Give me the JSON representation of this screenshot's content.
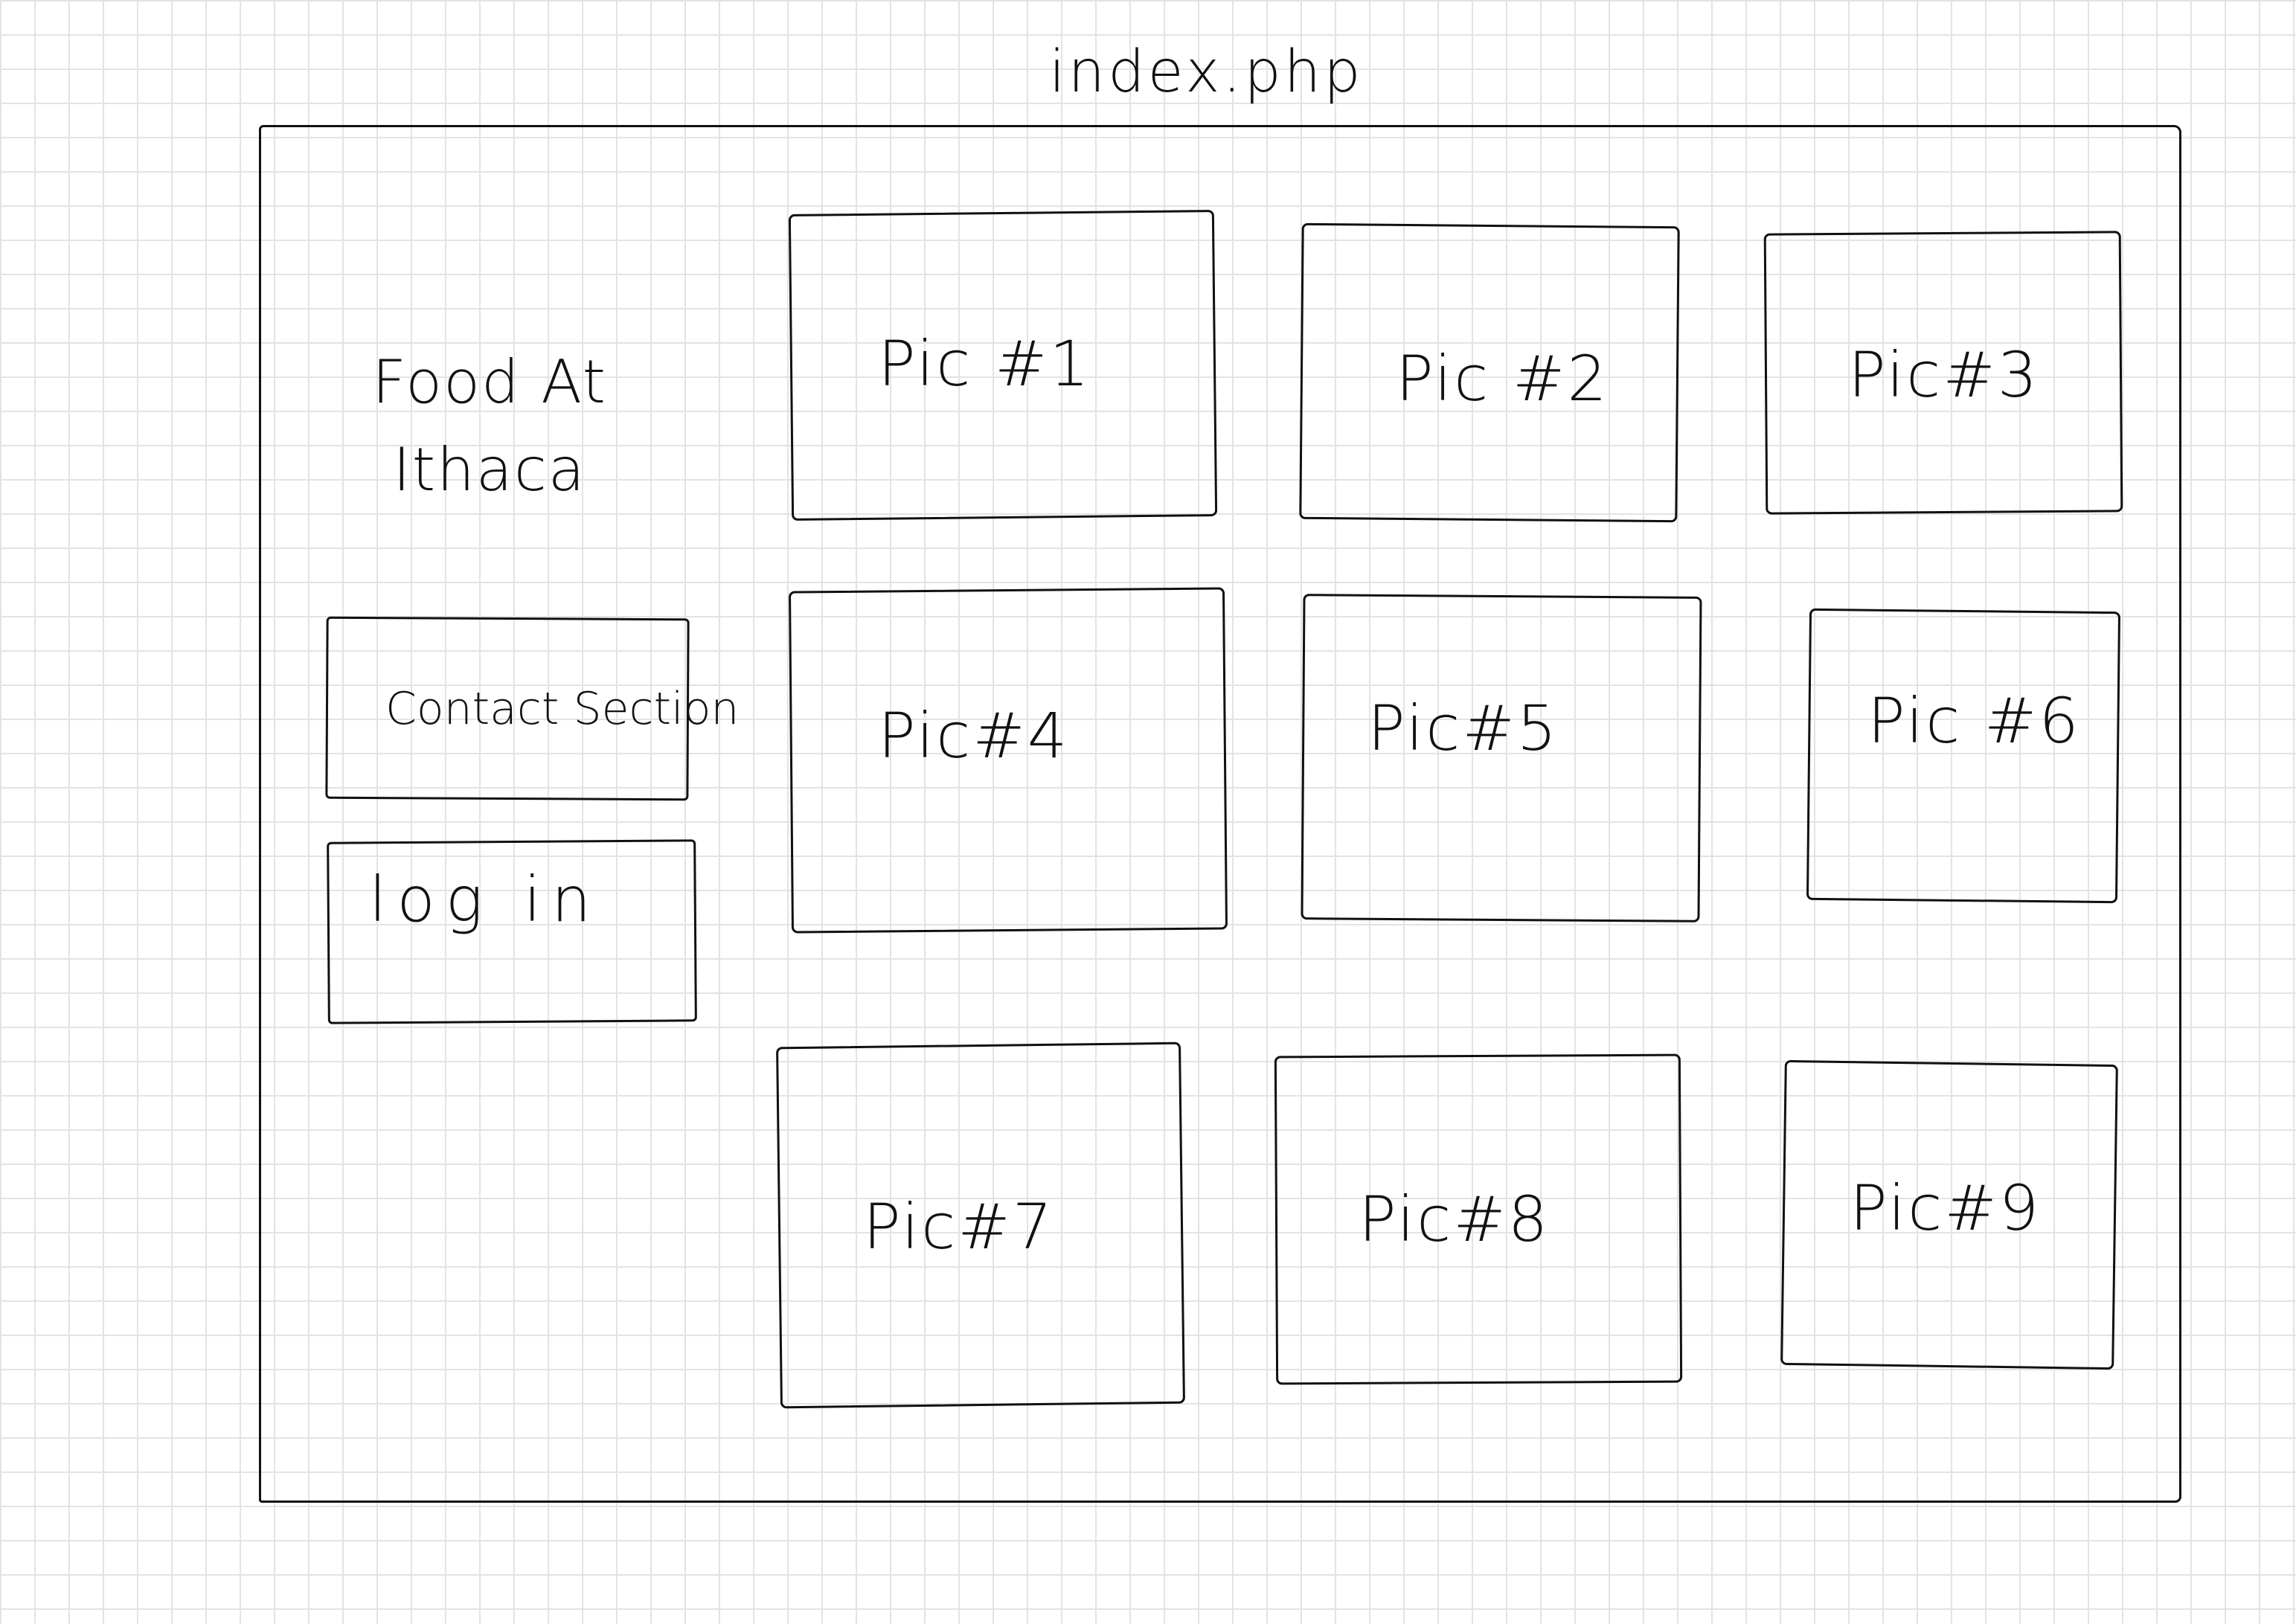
{
  "file_name": "index.php",
  "sidebar": {
    "title": "Food At\nIthaca",
    "contact_label": "Contact Section",
    "login_label": "log in"
  },
  "gallery": {
    "pics": [
      {
        "label": "Pic #1"
      },
      {
        "label": "Pic #2"
      },
      {
        "label": "Pic#3"
      },
      {
        "label": "Pic#4"
      },
      {
        "label": "Pic#5"
      },
      {
        "label": "Pic #6"
      },
      {
        "label": "Pic#7"
      },
      {
        "label": "Pic#8"
      },
      {
        "label": "Pic#9"
      }
    ]
  },
  "colors": {
    "ink": "#111111",
    "grid": "#e3e3e3",
    "paper": "#ffffff"
  }
}
